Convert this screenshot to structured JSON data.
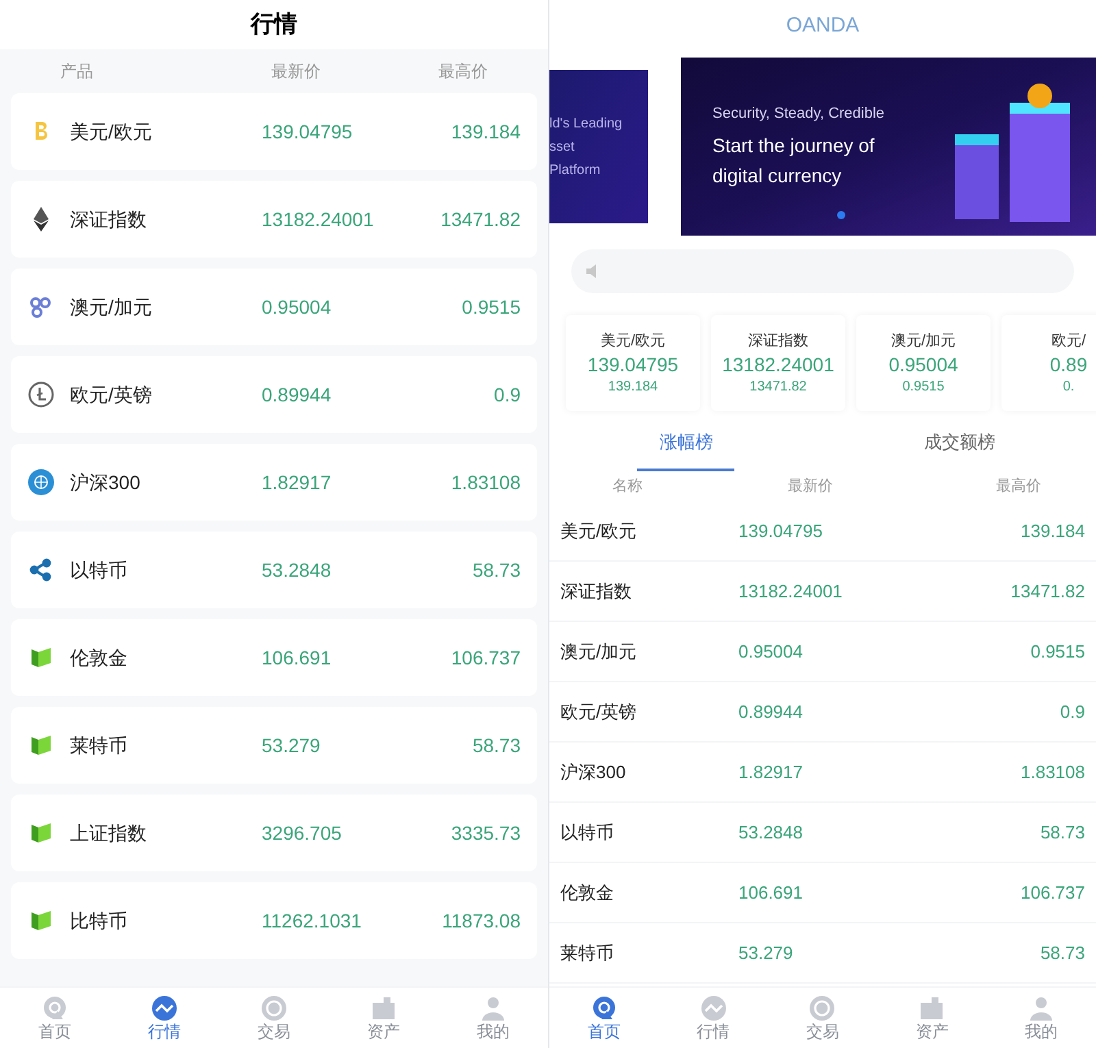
{
  "left_screen": {
    "title": "行情",
    "columns": [
      "产品",
      "最新价",
      "最高价"
    ],
    "rows": [
      {
        "kind": "bitcoin",
        "name": "美元/欧元",
        "latest": "139.04795",
        "high": "139.184"
      },
      {
        "kind": "ethereum",
        "name": "深证指数",
        "latest": "13182.24001",
        "high": "13471.82"
      },
      {
        "kind": "rings",
        "name": "澳元/加元",
        "latest": "0.95004",
        "high": "0.9515"
      },
      {
        "kind": "litecoin",
        "name": "欧元/英镑",
        "latest": "0.89944",
        "high": "0.9"
      },
      {
        "kind": "globe",
        "name": "沪深300",
        "latest": "1.82917",
        "high": "1.83108"
      },
      {
        "kind": "ripple",
        "name": "以特币",
        "latest": "53.2848",
        "high": "58.73"
      },
      {
        "kind": "neo",
        "name": "伦敦金",
        "latest": "106.691",
        "high": "106.737"
      },
      {
        "kind": "neo",
        "name": "莱特币",
        "latest": "53.279",
        "high": "58.73"
      },
      {
        "kind": "neo",
        "name": "上证指数",
        "latest": "3296.705",
        "high": "3335.73"
      },
      {
        "kind": "neo",
        "name": "比特币",
        "latest": "11262.1031",
        "high": "11873.08"
      }
    ],
    "nav": [
      {
        "kind": "home",
        "label": "首页",
        "selected": false
      },
      {
        "kind": "chart",
        "label": "行情",
        "selected": true
      },
      {
        "kind": "trade",
        "label": "交易",
        "selected": false
      },
      {
        "kind": "wallet",
        "label": "资产",
        "selected": false
      },
      {
        "kind": "user",
        "label": "我的",
        "selected": false
      }
    ]
  },
  "right_screen": {
    "title": "OANDA",
    "banner_peek": [
      "ld's Leading",
      "sset",
      "Platform"
    ],
    "banner": {
      "subtitle": "Security, Steady, Credible",
      "headline": [
        "Start the journey of",
        "digital currency"
      ]
    },
    "tickers": [
      {
        "name": "美元/欧元",
        "latest": "139.04795",
        "high": "139.184"
      },
      {
        "name": "深证指数",
        "latest": "13182.24001",
        "high": "13471.82"
      },
      {
        "name": "澳元/加元",
        "latest": "0.95004",
        "high": "0.9515"
      },
      {
        "name": "欧元/",
        "latest": "0.89",
        "high": "0."
      }
    ],
    "tabs": [
      {
        "label": "涨幅榜",
        "selected": true
      },
      {
        "label": "成交额榜",
        "selected": false
      }
    ],
    "columns": [
      "名称",
      "最新价",
      "最高价"
    ],
    "rows": [
      {
        "name": "美元/欧元",
        "latest": "139.04795",
        "high": "139.184"
      },
      {
        "name": "深证指数",
        "latest": "13182.24001",
        "high": "13471.82"
      },
      {
        "name": "澳元/加元",
        "latest": "0.95004",
        "high": "0.9515"
      },
      {
        "name": "欧元/英镑",
        "latest": "0.89944",
        "high": "0.9"
      },
      {
        "name": "沪深300",
        "latest": "1.82917",
        "high": "1.83108"
      },
      {
        "name": "以特币",
        "latest": "53.2848",
        "high": "58.73"
      },
      {
        "name": "伦敦金",
        "latest": "106.691",
        "high": "106.737"
      },
      {
        "name": "莱特币",
        "latest": "53.279",
        "high": "58.73"
      }
    ],
    "nav": [
      {
        "kind": "home",
        "label": "首页",
        "selected": true
      },
      {
        "kind": "chart",
        "label": "行情",
        "selected": false
      },
      {
        "kind": "trade",
        "label": "交易",
        "selected": false
      },
      {
        "kind": "wallet",
        "label": "资产",
        "selected": false
      },
      {
        "kind": "user",
        "label": "我的",
        "selected": false
      }
    ]
  }
}
